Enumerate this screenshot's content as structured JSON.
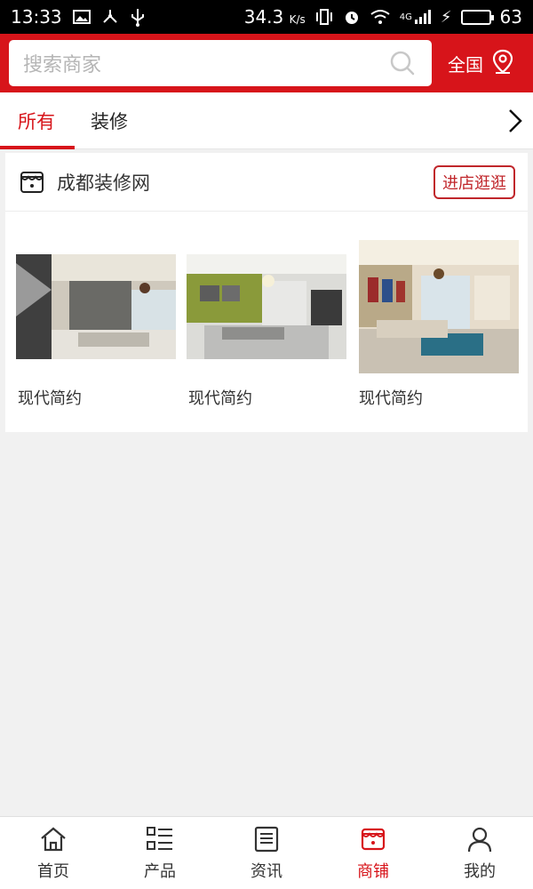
{
  "status": {
    "time": "13:33",
    "speed": "34.3",
    "speed_unit": "K/s",
    "network": "4G",
    "battery": "63",
    "battery_level": 0.63
  },
  "search": {
    "placeholder": "搜索商家",
    "region_label": "全国"
  },
  "tabs": [
    {
      "label": "所有",
      "active": true
    },
    {
      "label": "装修",
      "active": false
    }
  ],
  "shop": {
    "name": "成都装修网",
    "enter_label": "进店逛逛",
    "products": [
      {
        "name": "现代简约"
      },
      {
        "name": "现代简约"
      },
      {
        "name": "现代简约"
      }
    ]
  },
  "bottom_nav": [
    {
      "label": "首页",
      "icon": "home-icon",
      "active": false
    },
    {
      "label": "产品",
      "icon": "list-icon",
      "active": false
    },
    {
      "label": "资讯",
      "icon": "news-icon",
      "active": false
    },
    {
      "label": "商铺",
      "icon": "store-icon",
      "active": true
    },
    {
      "label": "我的",
      "icon": "user-icon",
      "active": false
    }
  ],
  "colors": {
    "brand_red": "#d7141a",
    "battery_green": "#3cdc3c"
  }
}
